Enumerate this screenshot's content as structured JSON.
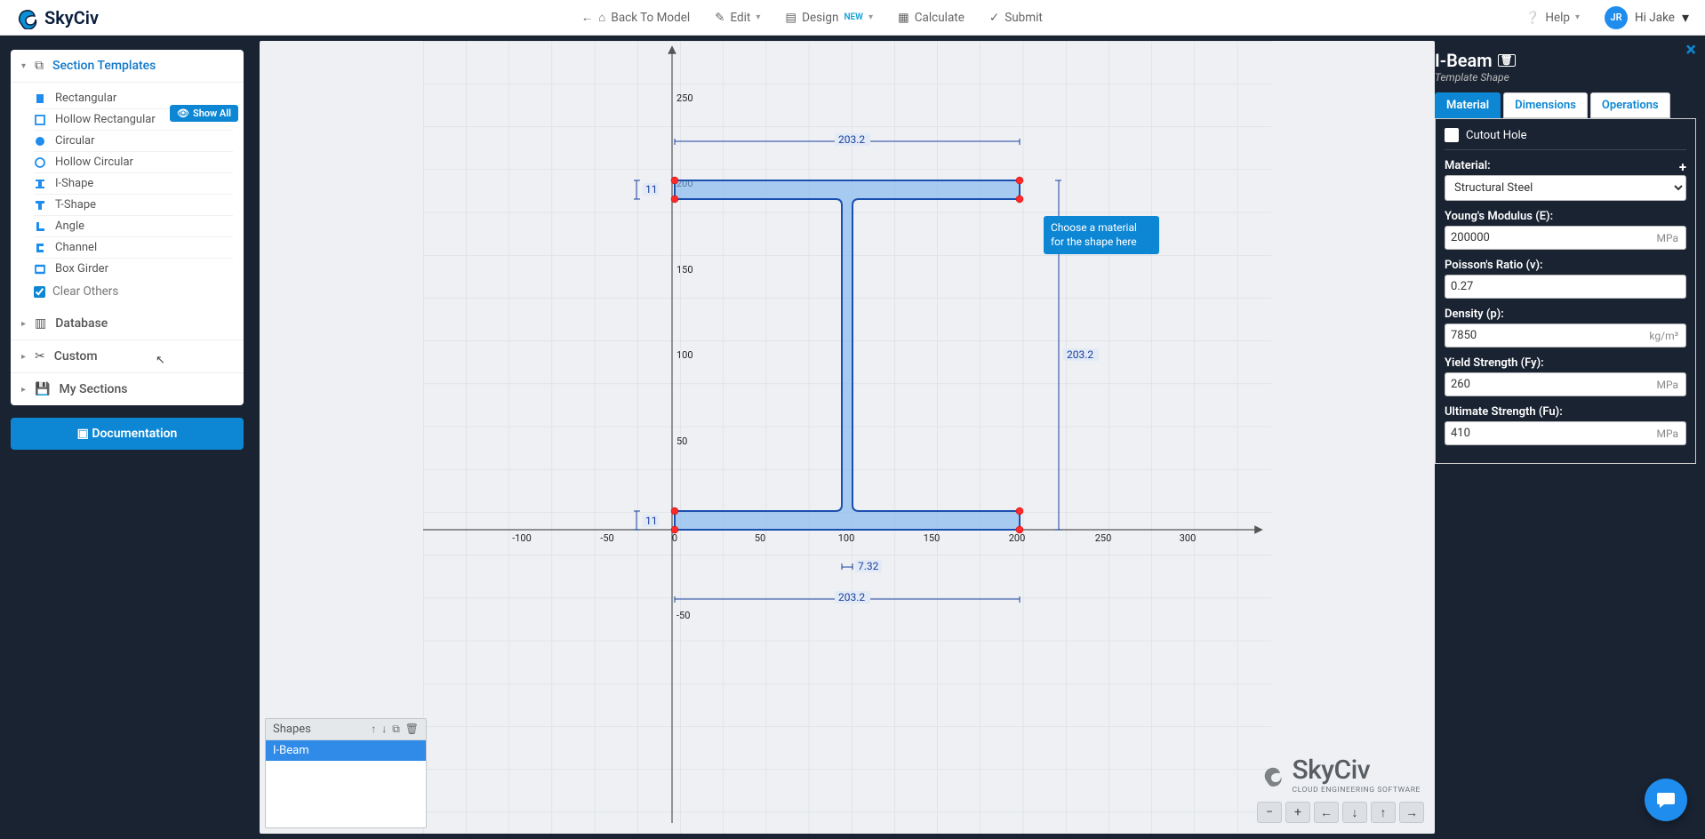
{
  "topbar": {
    "logo": "SkyCiv",
    "back": "Back To Model",
    "edit": "Edit",
    "design": "Design",
    "design_new": "NEW",
    "calculate": "Calculate",
    "submit": "Submit",
    "help": "Help",
    "user_initials": "JR",
    "greeting": "Hi Jake"
  },
  "sidebar": {
    "section_templates": "Section Templates",
    "show_all": "Show All",
    "templates": [
      "Rectangular",
      "Hollow Rectangular",
      "Circular",
      "Hollow Circular",
      "I-Shape",
      "T-Shape",
      "Angle",
      "Channel",
      "Box Girder"
    ],
    "clear_others": "Clear Others",
    "database": "Database",
    "custom": "Custom",
    "my_sections": "My Sections",
    "documentation": "Documentation"
  },
  "canvas": {
    "dim_width_top": "203.2",
    "dim_tf_top": "11",
    "dim_tf_bot": "11",
    "dim_y_200": "200",
    "dim_height_right": "203.2",
    "dim_tw": "7.32",
    "dim_width_bot": "203.2",
    "y_ticks": [
      "250",
      "200",
      "150",
      "100",
      "50",
      "-50"
    ],
    "x_ticks": [
      "-100",
      "-50",
      "0",
      "50",
      "100",
      "150",
      "200",
      "250",
      "300"
    ],
    "ctrl": [
      "−",
      "+",
      "←",
      "↓",
      "↑",
      "→"
    ],
    "watermark_big": "SkyCiv",
    "watermark_sub": "CLOUD ENGINEERING SOFTWARE"
  },
  "shapes_panel": {
    "title": "Shapes",
    "rows": [
      "I-Beam"
    ]
  },
  "tooltip": "Choose a material for the shape here",
  "props": {
    "title": "I-Beam",
    "subtitle": "Template Shape",
    "tabs": [
      "Material",
      "Dimensions",
      "Operations"
    ],
    "cutout": "Cutout Hole",
    "material_label": "Material:",
    "material_value": "Structural Steel",
    "young_label": "Young's Modulus (E):",
    "young_value": "200000",
    "young_unit": "MPa",
    "poisson_label": "Poisson's Ratio (v):",
    "poisson_value": "0.27",
    "density_label": "Density (p):",
    "density_value": "7850",
    "density_unit": "kg/m³",
    "yield_label": "Yield Strength (Fy):",
    "yield_value": "260",
    "yield_unit": "MPa",
    "ultimate_label": "Ultimate Strength (Fu):",
    "ultimate_value": "410",
    "ultimate_unit": "MPa"
  }
}
